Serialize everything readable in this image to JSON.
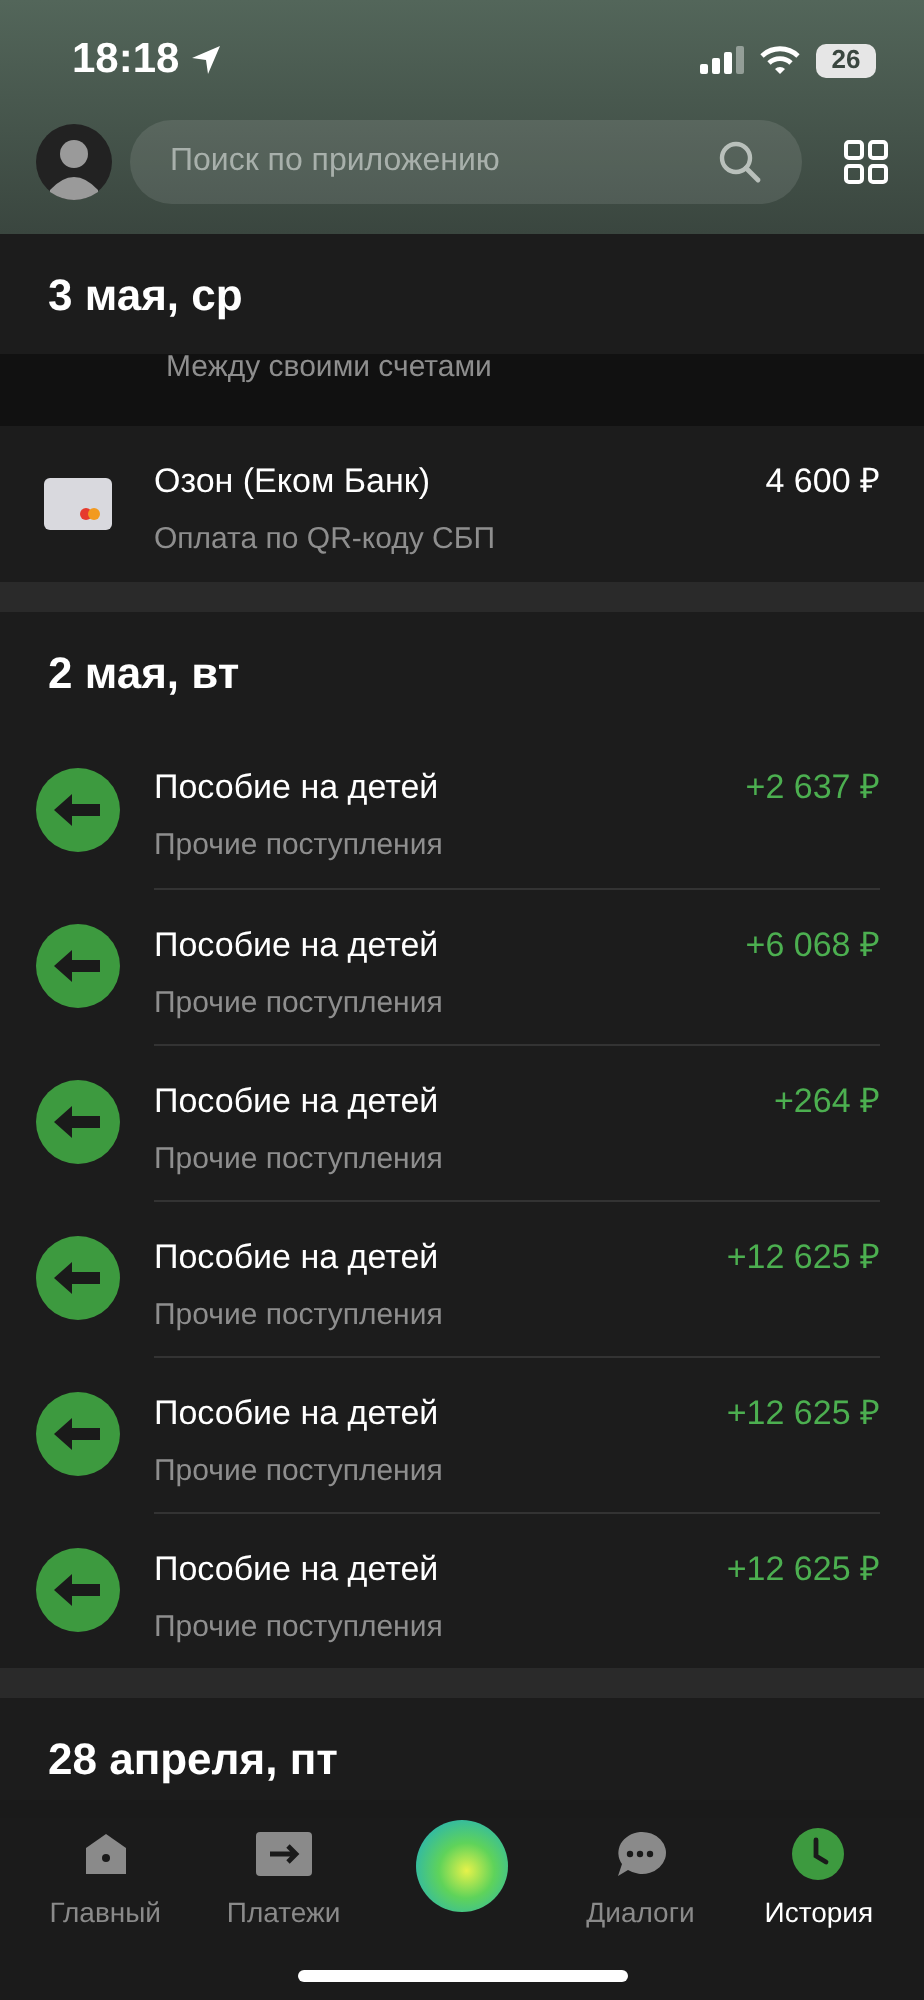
{
  "status_bar": {
    "time": "18:18",
    "battery": "26"
  },
  "search": {
    "placeholder": "Поиск по приложению"
  },
  "sections": [
    {
      "date": "3 мая, ср",
      "partial_row": {
        "subtitle": "Между своими счетами"
      },
      "transactions": [
        {
          "kind": "card",
          "title": "Озон (Еком Банк)",
          "subtitle": "Оплата по QR-коду СБП",
          "amount": "4 600 ₽"
        }
      ]
    },
    {
      "date": "2 мая, вт",
      "transactions": [
        {
          "kind": "incoming",
          "title": "Пособие на детей",
          "subtitle": "Прочие поступления",
          "amount": "+2 637 ₽"
        },
        {
          "kind": "incoming",
          "title": "Пособие на детей",
          "subtitle": "Прочие поступления",
          "amount": "+6 068 ₽"
        },
        {
          "kind": "incoming",
          "title": "Пособие на детей",
          "subtitle": "Прочие поступления",
          "amount": "+264 ₽"
        },
        {
          "kind": "incoming",
          "title": "Пособие на детей",
          "subtitle": "Прочие поступления",
          "amount": "+12 625 ₽"
        },
        {
          "kind": "incoming",
          "title": "Пособие на детей",
          "subtitle": "Прочие поступления",
          "amount": "+12 625 ₽"
        },
        {
          "kind": "incoming",
          "title": "Пособие на детей",
          "subtitle": "Прочие поступления",
          "amount": "+12 625 ₽"
        }
      ]
    },
    {
      "date": "28 апреля, пт"
    }
  ],
  "tab_bar": [
    {
      "kind": "home",
      "label": "Главный",
      "selected": false
    },
    {
      "kind": "payments",
      "label": "Платежи",
      "selected": false
    },
    {
      "kind": "assistant"
    },
    {
      "kind": "dialogs",
      "label": "Диалоги",
      "selected": false
    },
    {
      "kind": "history",
      "label": "История",
      "selected": true
    }
  ]
}
